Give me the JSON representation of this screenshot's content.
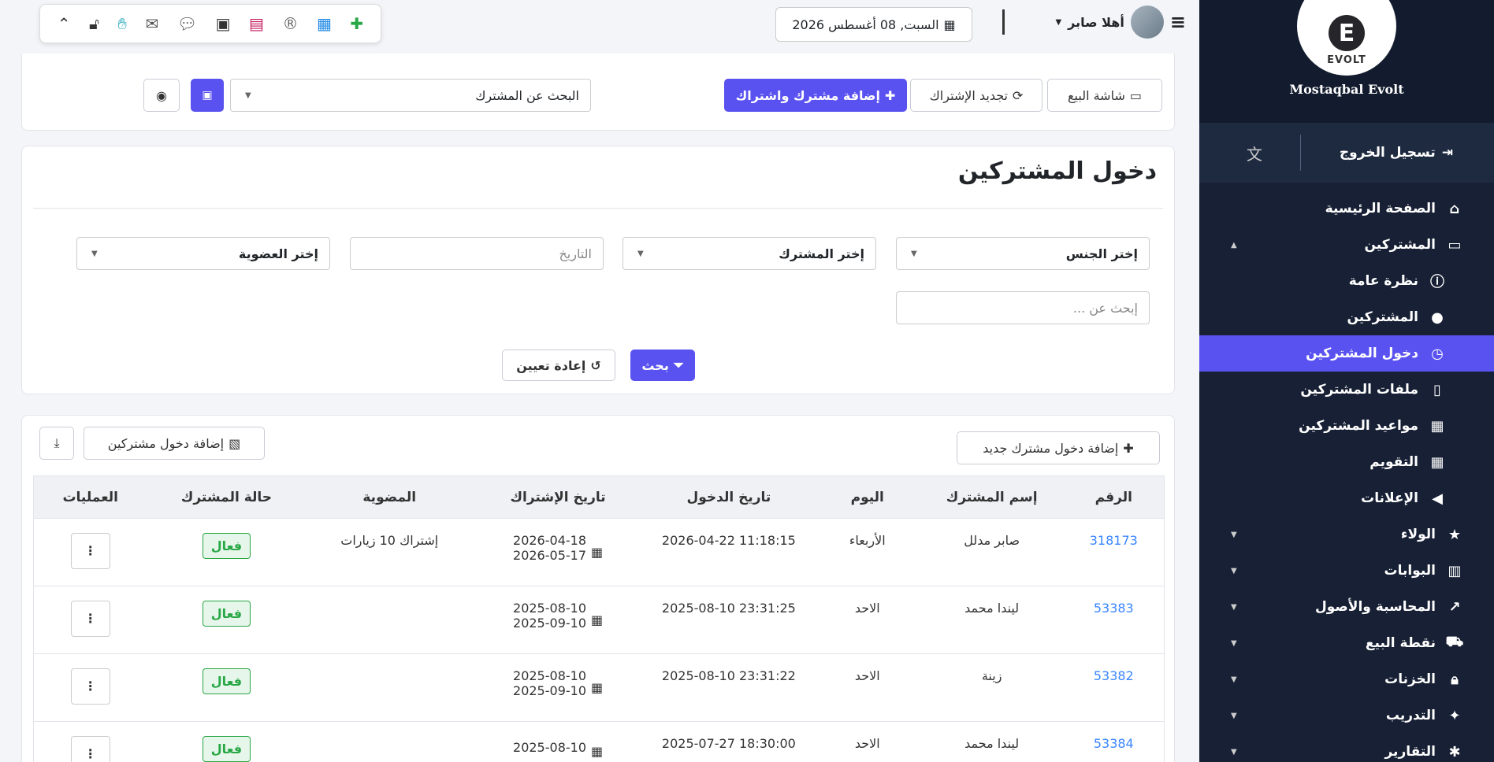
{
  "sidebar": {
    "brand": "Mostaqbal Evolt",
    "logo_letter": "E",
    "logo_sub": "EVOLT",
    "logout": "تسجيل الخروج",
    "items": [
      {
        "label": "الصفحة الرئيسية",
        "icon": "home-icon"
      },
      {
        "label": "المشتركين",
        "icon": "laptop-icon"
      },
      {
        "label": "نظرة عامة",
        "icon": "info-icon"
      },
      {
        "label": "المشتركين",
        "icon": "user-icon"
      },
      {
        "label": "دخول المشتركين",
        "icon": "clock-icon"
      },
      {
        "label": "ملفات المشتركين",
        "icon": "file-icon"
      },
      {
        "label": "مواعيد المشتركين",
        "icon": "calendar-icon"
      },
      {
        "label": "التقويم",
        "icon": "calendar-grid-icon"
      },
      {
        "label": "الإعلانات",
        "icon": "bullhorn-icon"
      },
      {
        "label": "الولاء",
        "icon": "star-icon"
      },
      {
        "label": "البوابات",
        "icon": "building-icon"
      },
      {
        "label": "المحاسبة والأصول",
        "icon": "chart-icon"
      },
      {
        "label": "نقطة البيع",
        "icon": "cart-icon"
      },
      {
        "label": "الخزنات",
        "icon": "lock-icon"
      },
      {
        "label": "التدريب",
        "icon": "wand-icon"
      },
      {
        "label": "التقارير",
        "icon": "bug-icon"
      }
    ]
  },
  "topbar": {
    "date": "السبت, 08 أغسطس 2026",
    "greeting": "أهلا صابر"
  },
  "actions": {
    "pos_screen": "شاشة البيع",
    "renew": "تجديد الإشتراك",
    "add_subscriber": "إضافة مشترك واشتراك",
    "search_subscriber": "البحث عن المشترك"
  },
  "filters": {
    "title": "دخول المشتركين",
    "gender": "إختر الجنس",
    "subscriber": "إختر المشترك",
    "date_placeholder": "التاريخ",
    "membership": "إختر العضوية",
    "search_placeholder": "إبحث عن ...",
    "search_btn": "بحث",
    "reset_btn": "إعادة تعيين"
  },
  "table": {
    "add_new": "إضافة دخول مشترك جديد",
    "import": "إضافة دخول مشتركين",
    "headers": [
      "الرقم",
      "إسم المشترك",
      "اليوم",
      "تاريخ الدخول",
      "تاريخ الإشتراك",
      "المضوية",
      "حالة المشترك",
      "العمليات"
    ],
    "rows": [
      {
        "id": "318173",
        "name": "صابر مدلل",
        "day": "الأربعاء",
        "entry": "2026-04-22 11:18:15",
        "sub_start": "2026-04-18",
        "sub_end": "2026-05-17",
        "membership": "إشتراك 10 زيارات",
        "status": "فعال"
      },
      {
        "id": "53383",
        "name": "ليندا محمد",
        "day": "الاحد",
        "entry": "2025-08-10 23:31:25",
        "sub_start": "2025-08-10",
        "sub_end": "2025-09-10",
        "membership": "",
        "status": "فعال"
      },
      {
        "id": "53382",
        "name": "زينة",
        "day": "الاحد",
        "entry": "2025-08-10 23:31:22",
        "sub_start": "2025-08-10",
        "sub_end": "2025-09-10",
        "membership": "",
        "status": "فعال"
      },
      {
        "id": "53384",
        "name": "ليندا محمد",
        "day": "الاحد",
        "entry": "2025-07-27 18:30:00",
        "sub_start": "2025-08-10",
        "sub_end": "",
        "membership": "",
        "status": "فعال"
      }
    ]
  }
}
